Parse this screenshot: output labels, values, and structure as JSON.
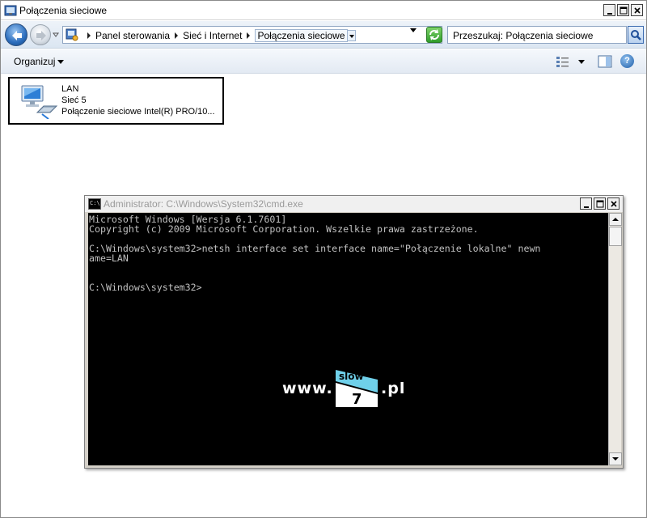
{
  "explorer": {
    "title": "Połączenia sieciowe",
    "breadcrumbs": [
      "Panel sterowania",
      "Sieć i Internet",
      "Połączenia sieciowe"
    ],
    "search_placeholder": "Przeszukaj: Połączenia sieciowe",
    "toolbar": {
      "organize_label": "Organizuj"
    },
    "connection": {
      "name": "LAN",
      "network": "Sieć  5",
      "adapter": "Połączenie sieciowe Intel(R) PRO/10..."
    }
  },
  "cmd": {
    "title": "Administrator: C:\\Windows\\System32\\cmd.exe",
    "icon_text": "C:\\",
    "lines": [
      "Microsoft Windows [Wersja 6.1.7601]",
      "Copyright (c) 2009 Microsoft Corporation. Wszelkie prawa zastrzeżone.",
      "",
      "C:\\Windows\\system32>netsh interface set interface name=\"Połączenie lokalne\" newn",
      "ame=LAN",
      "",
      "",
      "C:\\Windows\\system32>"
    ]
  },
  "watermark": {
    "prefix": "www.",
    "logo_top": "slow",
    "logo_bottom": "7",
    "suffix": ".pl"
  }
}
